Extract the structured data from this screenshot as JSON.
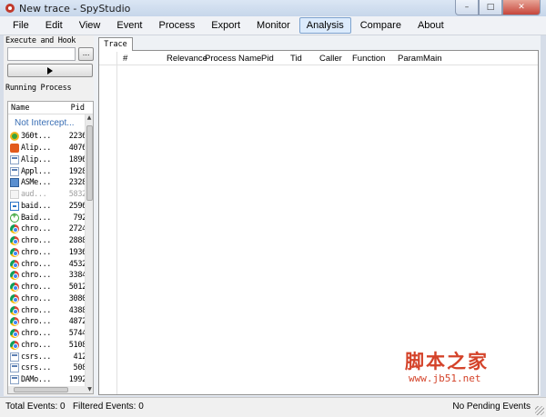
{
  "window": {
    "title": "New trace - SpyStudio",
    "icon": "spystudio-app-icon",
    "controls": {
      "minimize": "–",
      "maximize": "□",
      "close": "✕"
    }
  },
  "menu": {
    "items": [
      "File",
      "Edit",
      "View",
      "Event",
      "Process",
      "Export",
      "Monitor",
      "Analysis",
      "Compare",
      "About"
    ],
    "active": "Analysis"
  },
  "left": {
    "execute_label": "Execute and Hook",
    "exec_value": "",
    "browse_label": "...",
    "run_icon": "play-icon",
    "running_label": "Running Process",
    "columns": {
      "name": "Name",
      "pid": "Pid"
    },
    "not_intercepted": "Not Intercept...",
    "processes": [
      {
        "icon": "360-icon",
        "name": "360t...",
        "pid": "2236",
        "disabled": false
      },
      {
        "icon": "alipay-icon",
        "name": "Alip...",
        "pid": "4076",
        "disabled": false
      },
      {
        "icon": "app-icon",
        "name": "Alip...",
        "pid": "1896",
        "disabled": false
      },
      {
        "icon": "app-icon",
        "name": "Appl...",
        "pid": "1928",
        "disabled": false
      },
      {
        "icon": "asm-icon",
        "name": "ASMe...",
        "pid": "2328",
        "disabled": false
      },
      {
        "icon": "blank-icon",
        "name": "aud...",
        "pid": "5832",
        "disabled": true
      },
      {
        "icon": "baidu-pinyin-icon",
        "name": "baid...",
        "pid": "2596",
        "disabled": false
      },
      {
        "icon": "baidu-guard-icon",
        "name": "Baid...",
        "pid": "792",
        "disabled": false
      },
      {
        "icon": "chrome-icon",
        "name": "chro...",
        "pid": "2724",
        "disabled": false
      },
      {
        "icon": "chrome-icon",
        "name": "chro...",
        "pid": "2888",
        "disabled": false
      },
      {
        "icon": "chrome-icon",
        "name": "chro...",
        "pid": "1936",
        "disabled": false
      },
      {
        "icon": "chrome-icon",
        "name": "chro...",
        "pid": "4532",
        "disabled": false
      },
      {
        "icon": "chrome-icon",
        "name": "chro...",
        "pid": "3384",
        "disabled": false
      },
      {
        "icon": "chrome-icon",
        "name": "chro...",
        "pid": "5012",
        "disabled": false
      },
      {
        "icon": "chrome-icon",
        "name": "chro...",
        "pid": "3080",
        "disabled": false
      },
      {
        "icon": "chrome-icon",
        "name": "chro...",
        "pid": "4388",
        "disabled": false
      },
      {
        "icon": "chrome-icon",
        "name": "chro...",
        "pid": "4872",
        "disabled": false
      },
      {
        "icon": "chrome-icon",
        "name": "chro...",
        "pid": "5744",
        "disabled": false
      },
      {
        "icon": "chrome-icon",
        "name": "chro...",
        "pid": "5108",
        "disabled": false
      },
      {
        "icon": "app-icon",
        "name": "csrs...",
        "pid": "412",
        "disabled": false
      },
      {
        "icon": "app-icon",
        "name": "csrs...",
        "pid": "508",
        "disabled": false
      },
      {
        "icon": "app-icon",
        "name": "DAMo...",
        "pid": "1992",
        "disabled": false
      }
    ]
  },
  "trace": {
    "tab_label": "Trace",
    "columns": [
      "#",
      "Relevance",
      "Process Name",
      "Pid",
      "Tid",
      "Caller",
      "Function",
      "ParamMain"
    ]
  },
  "watermark": {
    "main": "脚本之家",
    "url": "www.jb51.net"
  },
  "status": {
    "total_events": "Total Events: 0",
    "filtered_events": "Filtered Events: 0",
    "pending": "No Pending Events"
  },
  "colors": {
    "accent_menu": "#dcebfc",
    "link_blue": "#3a6fb5",
    "watermark_red": "#d4432a"
  }
}
